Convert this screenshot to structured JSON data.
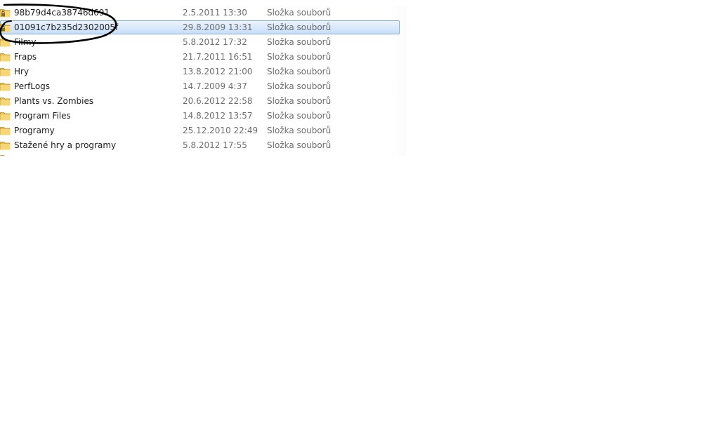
{
  "file_list": {
    "rows": [
      {
        "name": "98b79d4ca38746d691",
        "date": "2.5.2011 13:30",
        "type": "Složka souborů",
        "icon": "locked-folder-icon"
      },
      {
        "name": "01091c7b235d2302005f",
        "date": "29.8.2009 13:31",
        "type": "Složka souborů",
        "icon": "locked-folder-icon"
      },
      {
        "name": "Filmy",
        "date": "5.8.2012 17:32",
        "type": "Složka souborů",
        "icon": "folder-icon"
      },
      {
        "name": "Fraps",
        "date": "21.7.2011 16:51",
        "type": "Složka souborů",
        "icon": "folder-icon"
      },
      {
        "name": "Hry",
        "date": "13.8.2012 21:00",
        "type": "Složka souborů",
        "icon": "folder-icon"
      },
      {
        "name": "PerfLogs",
        "date": "14.7.2009 4:37",
        "type": "Složka souborů",
        "icon": "folder-icon"
      },
      {
        "name": "Plants vs. Zombies",
        "date": "20.6.2012 22:58",
        "type": "Složka souborů",
        "icon": "folder-icon"
      },
      {
        "name": "Program Files",
        "date": "14.8.2012 13:57",
        "type": "Složka souborů",
        "icon": "folder-icon"
      },
      {
        "name": "Programy",
        "date": "25.12.2010 22:49",
        "type": "Složka souborů",
        "icon": "folder-icon"
      },
      {
        "name": "Stažené hry a programy",
        "date": "5.8.2012 17:55",
        "type": "Složka souborů",
        "icon": "folder-icon"
      }
    ]
  },
  "colors": {
    "selection_border": "#84acdd",
    "selection_fill": "#d8e8fb",
    "folder": "#e8c15a",
    "annotation": "#000000"
  }
}
